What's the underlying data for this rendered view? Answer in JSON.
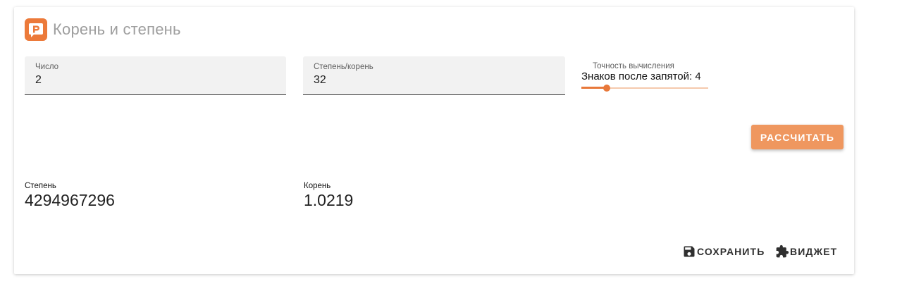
{
  "header": {
    "title": "Корень и степень",
    "logo_icon": "chat-bubble-p-icon",
    "accent_color": "#ec7a3a"
  },
  "inputs": {
    "number": {
      "label": "Число",
      "value": "2"
    },
    "power": {
      "label": "Степень/корень",
      "value": "32"
    }
  },
  "precision": {
    "caption": "Точность вычисления",
    "text": "Знаков после запятой: 4",
    "value": 4,
    "fraction": 0.2
  },
  "actions": {
    "calculate_label": "РАССЧИТАТЬ",
    "save_label": "СОХРАНИТЬ",
    "save_icon": "floppy-disk-icon",
    "widget_label": "ВИДЖЕТ",
    "widget_icon": "puzzle-piece-icon"
  },
  "results": {
    "power": {
      "label": "Степень",
      "value": "4294967296"
    },
    "root": {
      "label": "Корень",
      "value": "1.0219"
    }
  }
}
